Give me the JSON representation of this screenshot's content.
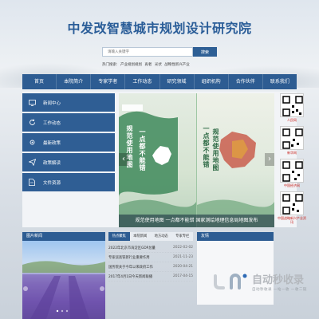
{
  "header": {
    "title": "中发改智慧城市规划设计研究院"
  },
  "search": {
    "placeholder": "请输入关键字",
    "button_label": "搜索"
  },
  "hot_search": {
    "label": "热门搜索:",
    "terms": [
      "产业规划规划",
      "再者",
      "光伏",
      "战略性新兴产业"
    ]
  },
  "nav": {
    "items": [
      "首页",
      "本院简介",
      "专家学者",
      "工作动态",
      "研究领域",
      "组织机构",
      "合作伙伴",
      "联系我们"
    ]
  },
  "side_menu": {
    "items": [
      {
        "label": "新闻中心",
        "icon": "monitor-icon"
      },
      {
        "label": "工作动态",
        "icon": "refresh-icon"
      },
      {
        "label": "最新政策",
        "icon": "gear-icon"
      },
      {
        "label": "政策解读",
        "icon": "send-icon"
      },
      {
        "label": "文件资源",
        "icon": "document-icon"
      }
    ]
  },
  "banner": {
    "left_text_1": "一点都不能错",
    "left_text_2": "规范使用地图",
    "right_text_1": "一点都不能错",
    "right_text_2": "规范使用地图",
    "caption": "规范使用地图 一点都不能错 国家测绘地理信息局地图发布"
  },
  "qr_codes": [
    {
      "label": "人民网"
    },
    {
      "label": "新华网"
    },
    {
      "label": "中国经济网"
    },
    {
      "label": "中国战略新兴产业资讯"
    }
  ],
  "photo_news": {
    "title": "图片新闻"
  },
  "news_tabs": [
    "热点聚焦",
    "本院新闻",
    "地方动态",
    "专家专栏"
  ],
  "news": [
    {
      "title": "2022年北京市海淀区GDP总量",
      "date": "2022-02-02"
    },
    {
      "title": "专家谈高铁新行业重要作用",
      "date": "2021-11-23"
    },
    {
      "title": "国务院关于今年以来政府工作",
      "date": "2020-04-21"
    },
    {
      "title": "2017年4月1日今天新闻联播",
      "date": "2017-04-15"
    }
  ],
  "friends": {
    "title": "友情"
  },
  "watermark": {
    "title": "自动秒收录",
    "subtitle": "自动秒收录 一站一收 一收二链"
  },
  "colors": {
    "primary": "#2d5c92",
    "title": "#2a5d98",
    "qr_label": "#c8201a"
  }
}
